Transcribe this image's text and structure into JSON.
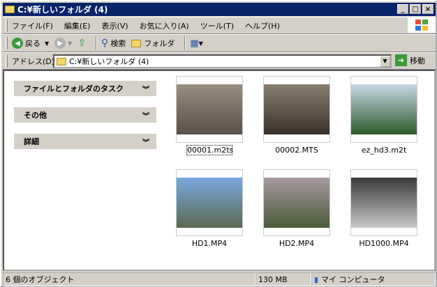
{
  "window": {
    "title": "C:¥新しいフォルダ (4)",
    "min": "_",
    "max": "□",
    "close": "×"
  },
  "menu": [
    "ファイル(F)",
    "編集(E)",
    "表示(V)",
    "お気に入り(A)",
    "ツール(T)",
    "ヘルプ(H)"
  ],
  "toolbar": {
    "back": "戻る",
    "search": "検索",
    "folders": "フォルダ"
  },
  "address": {
    "label": "アドレス(D)",
    "value": "C:¥新しいフォルダ (4)",
    "go": "移動"
  },
  "tasks": [
    "ファイルとフォルダのタスク",
    "その他",
    "詳細"
  ],
  "files": [
    {
      "name": "00001.m2ts",
      "colors": [
        "#9a8e80",
        "#5a5048"
      ]
    },
    {
      "name": "00002.MTS",
      "colors": [
        "#8a8070",
        "#3a3028"
      ]
    },
    {
      "name": "ez_hd3.m2t",
      "colors": [
        "#c8d8e8",
        "#2d5a2a"
      ]
    },
    {
      "name": "HD1.MP4",
      "colors": [
        "#7aa8e0",
        "#5a6a50"
      ]
    },
    {
      "name": "HD2.MP4",
      "colors": [
        "#a89aa0",
        "#4a5a38"
      ]
    },
    {
      "name": "HD1000.MP4",
      "colors": [
        "#3a3a38",
        "#c8c8c8"
      ]
    }
  ],
  "status": {
    "objects": "6 個のオブジェクト",
    "size": "130 MB",
    "location": "マイ コンピュータ"
  }
}
